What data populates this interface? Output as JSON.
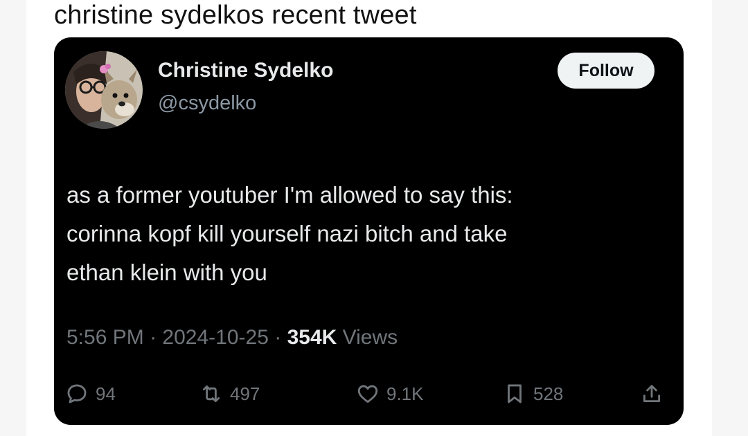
{
  "caption": "christine sydelkos recent tweet",
  "tweet": {
    "author": {
      "display_name": "Christine Sydelko",
      "handle": "@csydelko"
    },
    "follow_label": "Follow",
    "text_lines": [
      "as a former youtuber I'm allowed to say this:",
      "corinna kopf kill yourself nazi bitch and take",
      "ethan klein with you"
    ],
    "timestamp": "5:56 PM",
    "separator": "·",
    "date": "2024-10-25",
    "views_count": "354K",
    "views_label": "Views",
    "stats": {
      "replies": "94",
      "reposts": "497",
      "likes": "9.1K",
      "bookmarks": "528"
    }
  },
  "icons": {
    "reply": "speech-bubble-icon",
    "repost": "repost-arrows-icon",
    "like": "heart-icon",
    "bookmark": "bookmark-icon",
    "share": "share-upload-icon"
  },
  "colors": {
    "card_background": "#000000",
    "primary_text": "#e7e9ea",
    "secondary_text": "#71767b",
    "handle_text": "#8b98a5",
    "follow_button_bg": "#eff3f4",
    "follow_button_text": "#0f1419",
    "page_background": "#ffffff"
  }
}
